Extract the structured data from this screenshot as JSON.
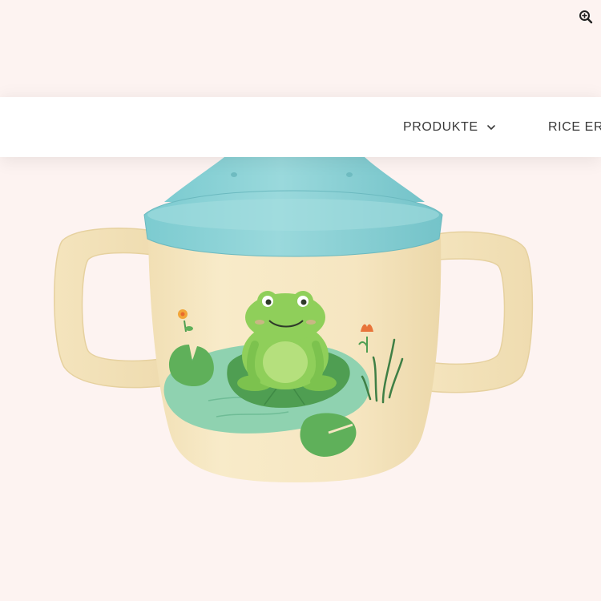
{
  "navbar": {
    "items": [
      {
        "label": "PRODUKTE",
        "has_dropdown": true,
        "icon": "chevron-down-icon"
      },
      {
        "label": "RICE ERL"
      }
    ]
  },
  "toolbar": {
    "zoom_icon": "zoom-in-icon"
  },
  "product_image": {
    "subject": "baby cup with two handles, turquoise lid, frog on lily pad print",
    "colors": {
      "cup_body": "#f7e9c6",
      "lid": "#86d3d6",
      "frog": "#8fcf5a",
      "lily_pad": "#5fae58",
      "pond": "#86cfa8",
      "background": "#fdf3f1"
    }
  }
}
